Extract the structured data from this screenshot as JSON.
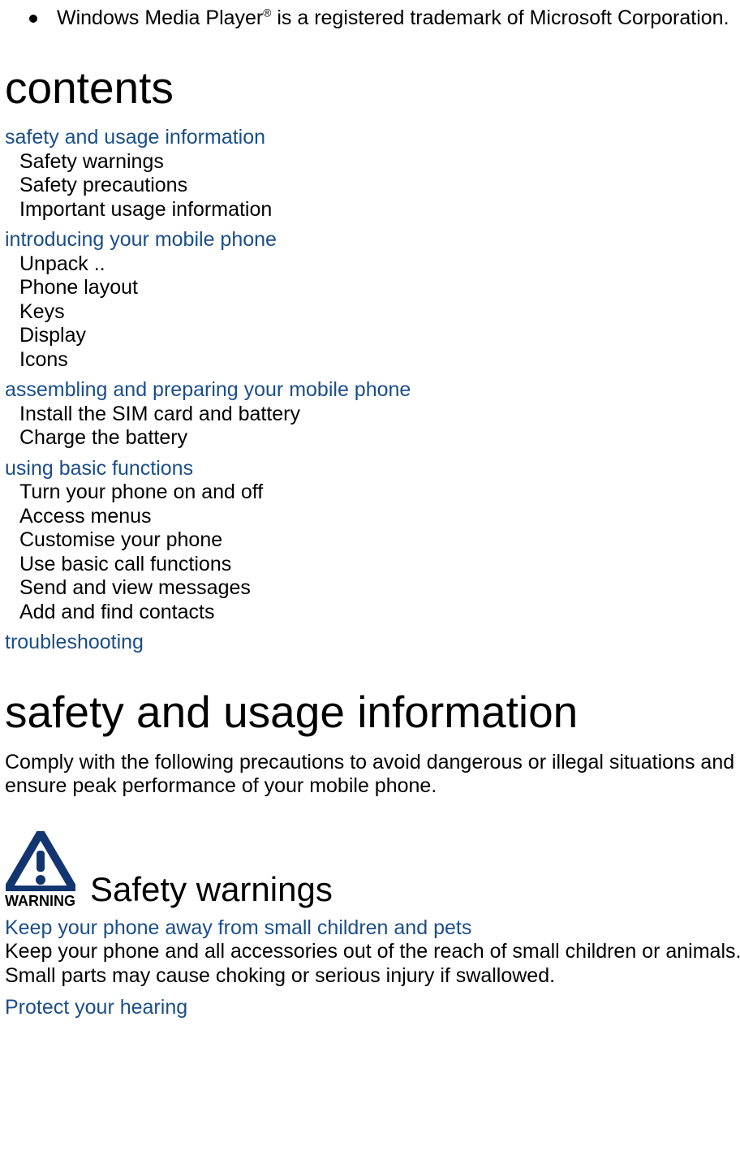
{
  "trademark": {
    "prefix": "Windows Media Player",
    "suffix": " is a registered trademark of Microsoft Corporation."
  },
  "headings": {
    "contents": "contents",
    "safety_usage": "safety and usage information",
    "safety_warnings": "Safety warnings"
  },
  "toc": {
    "s1": {
      "title": "safety and usage information",
      "items": [
        "Safety warnings",
        "Safety precautions",
        "Important usage information"
      ]
    },
    "s2": {
      "title": "introducing your mobile phone",
      "items": [
        "Unpack  ..",
        "Phone layout",
        "Keys",
        "Display",
        "Icons"
      ]
    },
    "s3": {
      "title": "assembling and preparing your mobile phone",
      "items": [
        "Install the SIM card and battery",
        "Charge the battery"
      ]
    },
    "s4": {
      "title": "using basic functions",
      "items": [
        "Turn your phone on and off",
        "Access menus",
        "Customise your phone",
        "Use basic call functions",
        "Send and view messages",
        "Add and find contacts"
      ]
    },
    "s5": {
      "title": "troubleshooting"
    }
  },
  "intro_para": "Comply with the following precautions to avoid dangerous or illegal situations and ensure peak performance of your mobile phone.",
  "warning_label": "WARNING",
  "warn1": {
    "head": "Keep your phone away from small children and pets",
    "body": "Keep your phone and all accessories out of the reach of small children or animals. Small parts may cause choking or serious injury if swallowed."
  },
  "warn2": {
    "head": "Protect your hearing"
  }
}
